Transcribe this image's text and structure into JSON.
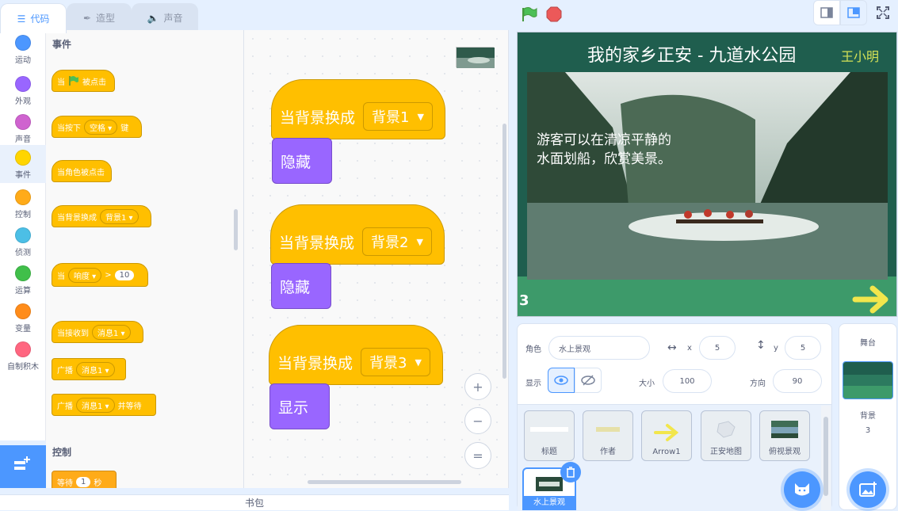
{
  "tabs": [
    {
      "label": "代码",
      "icon": "code-icon",
      "active": true
    },
    {
      "label": "造型",
      "icon": "brush-icon",
      "active": false
    },
    {
      "label": "声音",
      "icon": "speaker-icon",
      "active": false
    }
  ],
  "categories": [
    {
      "label": "运动",
      "color": "#4c97ff"
    },
    {
      "label": "外观",
      "color": "#9966ff"
    },
    {
      "label": "声音",
      "color": "#cf63cf"
    },
    {
      "label": "事件",
      "color": "#ffd500",
      "selected": true
    },
    {
      "label": "控制",
      "color": "#ffab19"
    },
    {
      "label": "侦测",
      "color": "#4cbfe6"
    },
    {
      "label": "运算",
      "color": "#40bf4a"
    },
    {
      "label": "变量",
      "color": "#ff8c1a"
    },
    {
      "label": "自制积木",
      "color": "#ff6680"
    }
  ],
  "palette": {
    "section_events": "事件",
    "section_control": "控制",
    "when_flag_1": "当",
    "when_flag_2": "被点击",
    "when_key_1": "当按下",
    "when_key_value": "空格",
    "when_key_2": "键",
    "when_sprite_clicked": "当角色被点击",
    "when_backdrop": "当背景换成",
    "when_backdrop_value": "背景1",
    "when_loud_1": "当",
    "when_loud_value": "响度",
    "when_loud_op": ">",
    "when_loud_num": "10",
    "when_receive": "当接收到",
    "when_receive_value": "消息1",
    "broadcast": "广播",
    "broadcast_value": "消息1",
    "broadcast_wait": "广播",
    "broadcast_wait_value": "消息1",
    "broadcast_wait_suffix": "并等待",
    "wait_label": "等待",
    "wait_num": "1",
    "wait_unit": "秒"
  },
  "scripts": [
    {
      "hat": "当背景换成",
      "value": "背景1",
      "action": "隐藏"
    },
    {
      "hat": "当背景换成",
      "value": "背景2",
      "action": "隐藏"
    },
    {
      "hat": "当背景换成",
      "value": "背景3",
      "action": "显示"
    }
  ],
  "zoom_controls": {
    "in": "+",
    "out": "−",
    "reset": "="
  },
  "stage": {
    "title": "我的家乡正安 - 九道水公园",
    "author": "王小明",
    "caption_line1": "游客可以在清凉平静的",
    "caption_line2": "水面划船，欣赏美景。",
    "backdrop_number": "3"
  },
  "sprite_info": {
    "sprite_label": "角色",
    "sprite_name": "水上景观",
    "x_label": "x",
    "x_value": "5",
    "y_label": "y",
    "y_value": "5",
    "show_label": "显示",
    "size_label": "大小",
    "size_value": "100",
    "direction_label": "方向",
    "direction_value": "90"
  },
  "sprites": [
    {
      "name": "标题"
    },
    {
      "name": "作者"
    },
    {
      "name": "Arrow1"
    },
    {
      "name": "正安地图"
    },
    {
      "name": "俯视景观"
    },
    {
      "name": "水上景观",
      "selected": true
    }
  ],
  "stage_panel": {
    "title": "舞台",
    "backdrop_label": "背景",
    "backdrop_count": "3"
  },
  "backpack_label": "书包",
  "colors": {
    "events": "#ffbf00",
    "looks": "#9966ff",
    "accent": "#4c97ff"
  }
}
